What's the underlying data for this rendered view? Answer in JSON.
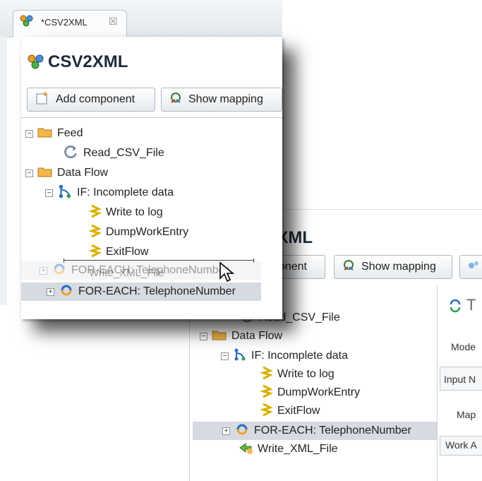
{
  "editor_tab": {
    "label": "*CSV2XML",
    "close": "☒"
  },
  "front": {
    "title": "CSV2XML",
    "add_component": "Add component",
    "show_mapping": "Show mapping",
    "tree": {
      "feed": "Feed",
      "read_csv": "Read_CSV_File",
      "data_flow": "Data Flow",
      "if_incomplete": "IF: Incomplete data",
      "write_log": "Write to log",
      "dump_work": "DumpWorkEntry",
      "exit_flow": "ExitFlow",
      "ghost_text": "FOR-EACH: TelephoneNumber",
      "ghost_text_2": "Write_XML_File",
      "for_each": "FOR-EACH: TelephoneNumber"
    }
  },
  "back": {
    "title_partial": "2XML",
    "title_char": "I",
    "add_component_partial": "ponent",
    "show_mapping": "Show mapping",
    "right_title_partial": "T",
    "tree": {
      "read_csv": "Read_CSV_File",
      "data_flow": "Data Flow",
      "if_incomplete": "IF: Incomplete data",
      "write_log": "Write to log",
      "dump_work": "DumpWorkEntry",
      "exit_flow": "ExitFlow",
      "for_each": "FOR-EACH: TelephoneNumber",
      "write_xml": "Write_XML_File"
    },
    "right": {
      "mode": "Mode",
      "input": "Input N",
      "map": "Map",
      "work": "Work A"
    }
  },
  "colors": {
    "folder": "#f2b84a",
    "selection": "#d6dbe1",
    "accent": "#2a6fbf"
  }
}
